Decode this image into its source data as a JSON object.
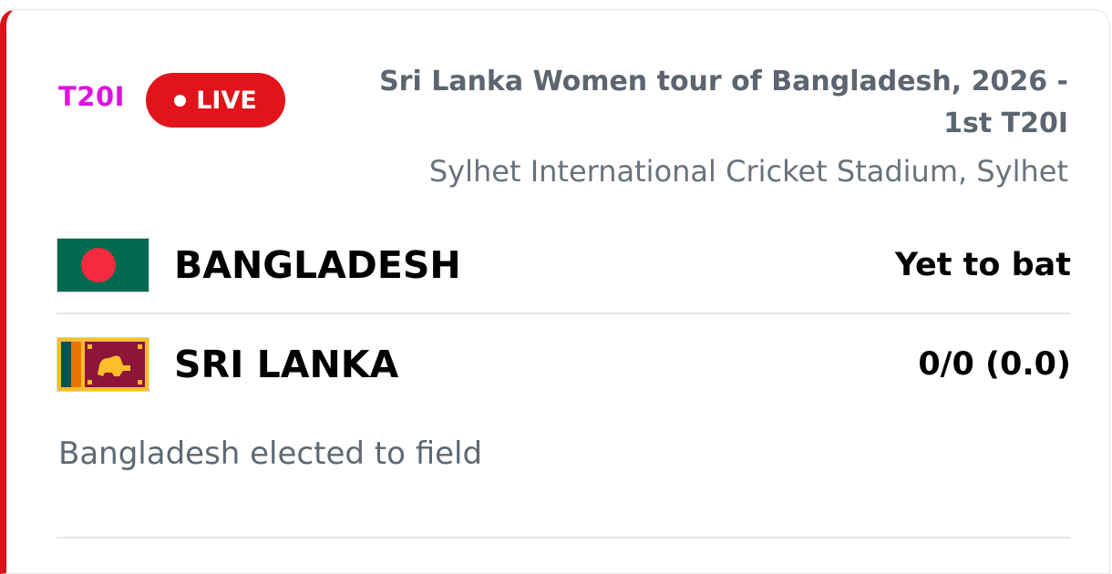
{
  "match": {
    "format": "T20I",
    "live_label": "LIVE",
    "series": "Sri Lanka Women tour of Bangladesh, 2026 - 1st T20I",
    "venue": "Sylhet International Cricket Stadium, Sylhet",
    "status": "Bangladesh elected to field"
  },
  "teams": [
    {
      "name": "BANGLADESH",
      "score": "Yet to bat",
      "flag": "bangladesh-flag-icon"
    },
    {
      "name": "SRI LANKA",
      "score": "0/0 (0.0)",
      "flag": "sri-lanka-flag-icon"
    }
  ],
  "colors": {
    "accent_red": "#d7141a",
    "format_magenta": "#e012e0",
    "live_red": "#e0141a",
    "muted_text": "#5c6570"
  }
}
